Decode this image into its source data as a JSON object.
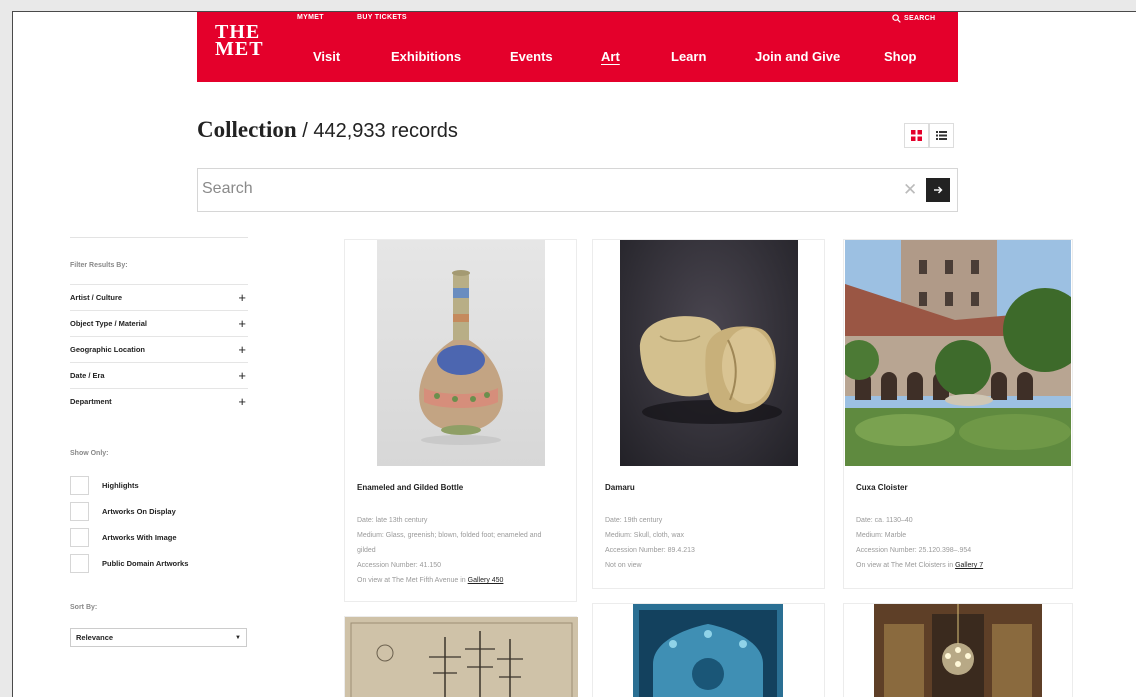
{
  "header": {
    "logo_line1": "THE",
    "logo_line2": "MET",
    "utility": {
      "mymet": "MYMET",
      "tickets": "BUY TICKETS",
      "search": "SEARCH"
    },
    "nav": [
      "Visit",
      "Exhibitions",
      "Events",
      "Art",
      "Learn",
      "Join and Give",
      "Shop"
    ],
    "active_nav": "Art",
    "brand_color": "#e4002b"
  },
  "collection": {
    "title": "Collection",
    "separator": " / ",
    "count": "442,933 records"
  },
  "search": {
    "placeholder": "Search"
  },
  "sidebar": {
    "filter_heading": "Filter Results By:",
    "filters": [
      "Artist / Culture",
      "Object Type / Material",
      "Geographic Location",
      "Date / Era",
      "Department"
    ],
    "show_heading": "Show Only:",
    "checkboxes": [
      "Highlights",
      "Artworks On Display",
      "Artworks With Image",
      "Public Domain Artworks"
    ],
    "sort_heading": "Sort By:",
    "sort_value": "Relevance"
  },
  "cards": [
    {
      "title": "Enameled and Gilded Bottle",
      "date": "Date:  late 13th century",
      "medium": "Medium:  Glass, greenish; blown, folded foot; enameled and gilded",
      "accession": "Accession Number:  41.150",
      "location_prefix": "On view at The Met Fifth Avenue in ",
      "location_link": "Gallery 450"
    },
    {
      "title": "Damaru",
      "date": "Date:  19th century",
      "medium": "Medium:  Skull, cloth, wax",
      "accession": "Accession Number:  89.4.213",
      "location_prefix": "Not on view",
      "location_link": ""
    },
    {
      "title": "Cuxa Cloister",
      "date": "Date:  ca. 1130–40",
      "medium": "Medium:  Marble",
      "accession": "Accession Number:  25.120.398–.954",
      "location_prefix": "On view at The Met Cloisters in ",
      "location_link": "Gallery 7"
    }
  ]
}
